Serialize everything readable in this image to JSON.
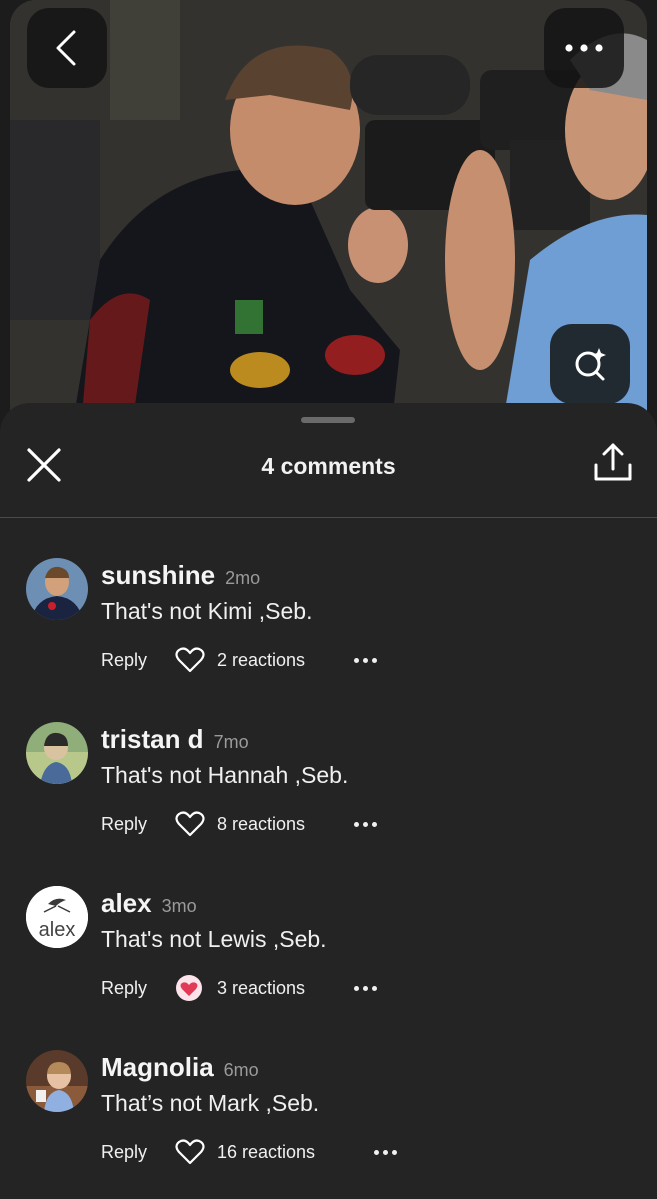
{
  "photo": {
    "back_icon": "chevron-left-icon",
    "more_icon": "more-horizontal-icon",
    "lens_icon": "visual-search-sparkle-icon"
  },
  "sheet": {
    "title": "4 comments",
    "close_icon": "close-icon",
    "share_icon": "share-upload-icon"
  },
  "actions": {
    "reply_label": "Reply"
  },
  "comments": [
    {
      "user": "sunshine",
      "time": "2mo",
      "text": "That's not Kimi ,Seb.",
      "reactions": "2 reactions",
      "reaction_icon": "heart-outline-icon"
    },
    {
      "user": "tristan d",
      "time": "7mo",
      "text": "That's not Hannah ,Seb.",
      "reactions": "8 reactions",
      "reaction_icon": "heart-outline-icon"
    },
    {
      "user": "alex",
      "time": "3mo",
      "text": "That's not Lewis ,Seb.",
      "reactions": "3 reactions",
      "reaction_icon": "heart-eyes-emoji-icon",
      "avatar_text": "alex"
    },
    {
      "user": "Magnolia",
      "time": "6mo",
      "text": "That’s not Mark ,Seb.",
      "reactions": "16 reactions",
      "reaction_icon": "heart-outline-icon"
    }
  ],
  "colors": {
    "sheet_bg": "#242424",
    "page_bg": "#1c1c1c",
    "muted_text": "#9a9a9a",
    "divider": "#4a4a4a"
  }
}
